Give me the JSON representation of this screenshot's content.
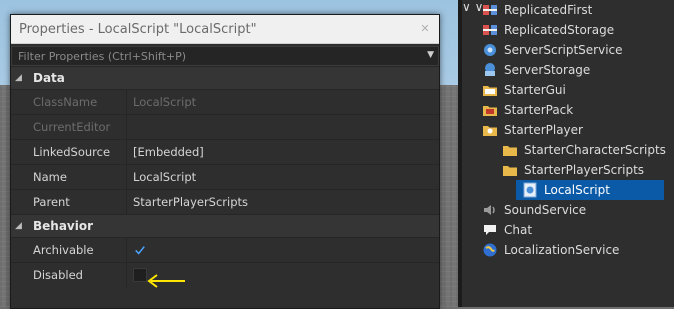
{
  "properties": {
    "title": "Properties - LocalScript \"LocalScript\"",
    "filter_placeholder": "Filter Properties (Ctrl+Shift+P)",
    "sections": {
      "data": {
        "label": "Data",
        "rows": {
          "classname": {
            "name": "ClassName",
            "value": "LocalScript"
          },
          "currenteditor": {
            "name": "CurrentEditor",
            "value": ""
          },
          "linkedsource": {
            "name": "LinkedSource",
            "value": "[Embedded]"
          },
          "name": {
            "name": "Name",
            "value": "LocalScript"
          },
          "parent": {
            "name": "Parent",
            "value": "StarterPlayerScripts"
          }
        }
      },
      "behavior": {
        "label": "Behavior",
        "rows": {
          "archivable": {
            "name": "Archivable",
            "checked": true
          },
          "disabled": {
            "name": "Disabled",
            "checked": false
          }
        }
      }
    }
  },
  "explorer": {
    "items": [
      {
        "label": "ReplicatedFirst",
        "icon": "replicated-first-icon"
      },
      {
        "label": "ReplicatedStorage",
        "icon": "replicated-storage-icon"
      },
      {
        "label": "ServerScriptService",
        "icon": "server-script-service-icon"
      },
      {
        "label": "ServerStorage",
        "icon": "server-storage-icon"
      },
      {
        "label": "StarterGui",
        "icon": "folder-icon"
      },
      {
        "label": "StarterPack",
        "icon": "folder-icon"
      },
      {
        "label": "StarterPlayer",
        "icon": "folder-icon"
      },
      {
        "label": "StarterCharacterScripts",
        "icon": "folder-icon"
      },
      {
        "label": "StarterPlayerScripts",
        "icon": "folder-icon"
      },
      {
        "label": "LocalScript",
        "icon": "local-script-icon"
      },
      {
        "label": "SoundService",
        "icon": "speaker-icon"
      },
      {
        "label": "Chat",
        "icon": "chat-bubble-icon"
      },
      {
        "label": "LocalizationService",
        "icon": "globe-icon"
      }
    ]
  },
  "colors": {
    "selection": "#0b5aa8",
    "annotation_arrow": "#ffe600",
    "check": "#4aa3ff"
  }
}
